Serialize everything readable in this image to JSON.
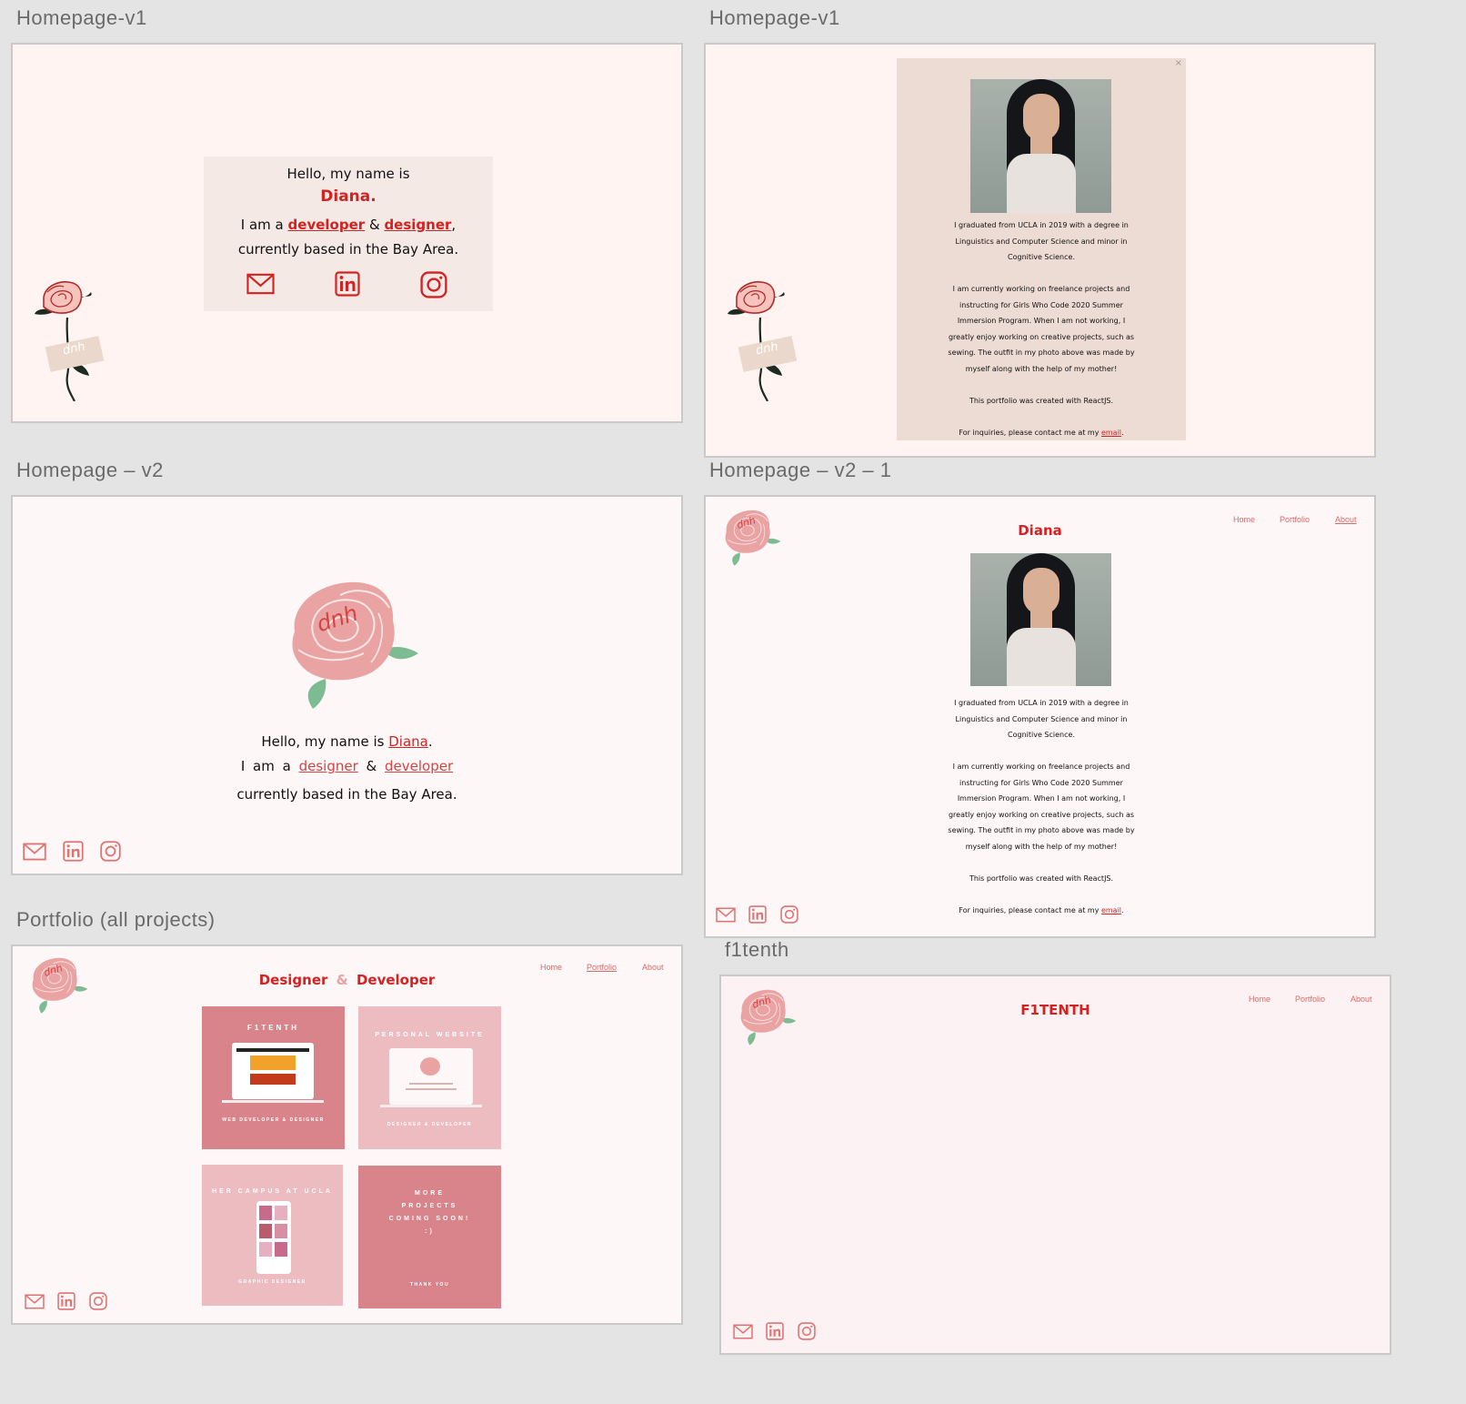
{
  "frames": {
    "home_v1": {
      "label": "Homepage-v1"
    },
    "home_v1_about": {
      "label": "Homepage-v1"
    },
    "home_v2": {
      "label": "Homepage – v2"
    },
    "home_v2_1": {
      "label": "Homepage – v2 – 1"
    },
    "portfolio": {
      "label": "Portfolio (all projects)"
    },
    "f1tenth": {
      "label": "f1tenth"
    }
  },
  "logo": {
    "initials": "dnh"
  },
  "intro_v1": {
    "greeting": "Hello, my name is",
    "name": "Diana.",
    "i_am_a": "I am a",
    "developer": "developer",
    "amp": "&",
    "designer": "designer",
    "comma": ",",
    "location": "currently based in the Bay Area."
  },
  "intro_v2": {
    "greeting": "Hello, my name is",
    "name": "Diana",
    "period": ".",
    "i_am_a": "I am a",
    "designer": "designer",
    "amp": "&",
    "developer": "developer",
    "location": "currently based in the Bay Area."
  },
  "nav": {
    "home": "Home",
    "portfolio": "Portfolio",
    "about": "About"
  },
  "about": {
    "close": "×",
    "title": "Diana",
    "p1": "I graduated from UCLA in 2019 with a degree in Linguistics and Computer Science and minor in Cognitive Science.",
    "p2": "I am currently working on freelance projects and instructing for Girls Who Code 2020 Summer Immersion Program. When I am not working, I greatly enjoy working on creative projects, such as sewing. The outfit in my photo above was made by myself along with the help of my mother!",
    "p3": "This portfolio was created with ReactJS.",
    "p4_pre": "For inquiries, please contact me at my",
    "p4_link": "email",
    "p4_post": "."
  },
  "portfolio": {
    "heading_a": "Designer",
    "heading_amp": "&",
    "heading_b": "Developer",
    "cards": [
      {
        "title": "F1TENTH",
        "subtitle": "WEB DEVELOPER & DESIGNER",
        "color": "#d9848b"
      },
      {
        "title": "PERSONAL WEBSITE",
        "subtitle": "DESIGNER & DEVELOPER",
        "color": "#ecbcc1"
      },
      {
        "title": "HER CAMPUS AT UCLA",
        "subtitle": "GRAPHIC DESIGNER",
        "color": "#ecbcc1"
      },
      {
        "title": "MORE PROJECTS COMING SOON! :)",
        "subtitle": "THANK YOU",
        "color": "#d9848b"
      }
    ]
  },
  "f1tenth": {
    "title": "F1TENTH"
  },
  "colors": {
    "accent": "#d42222",
    "rose": "#e9a3a3",
    "leaf": "#7dbb93"
  },
  "icons": [
    "mail-icon",
    "linkedin-icon",
    "instagram-icon"
  ]
}
